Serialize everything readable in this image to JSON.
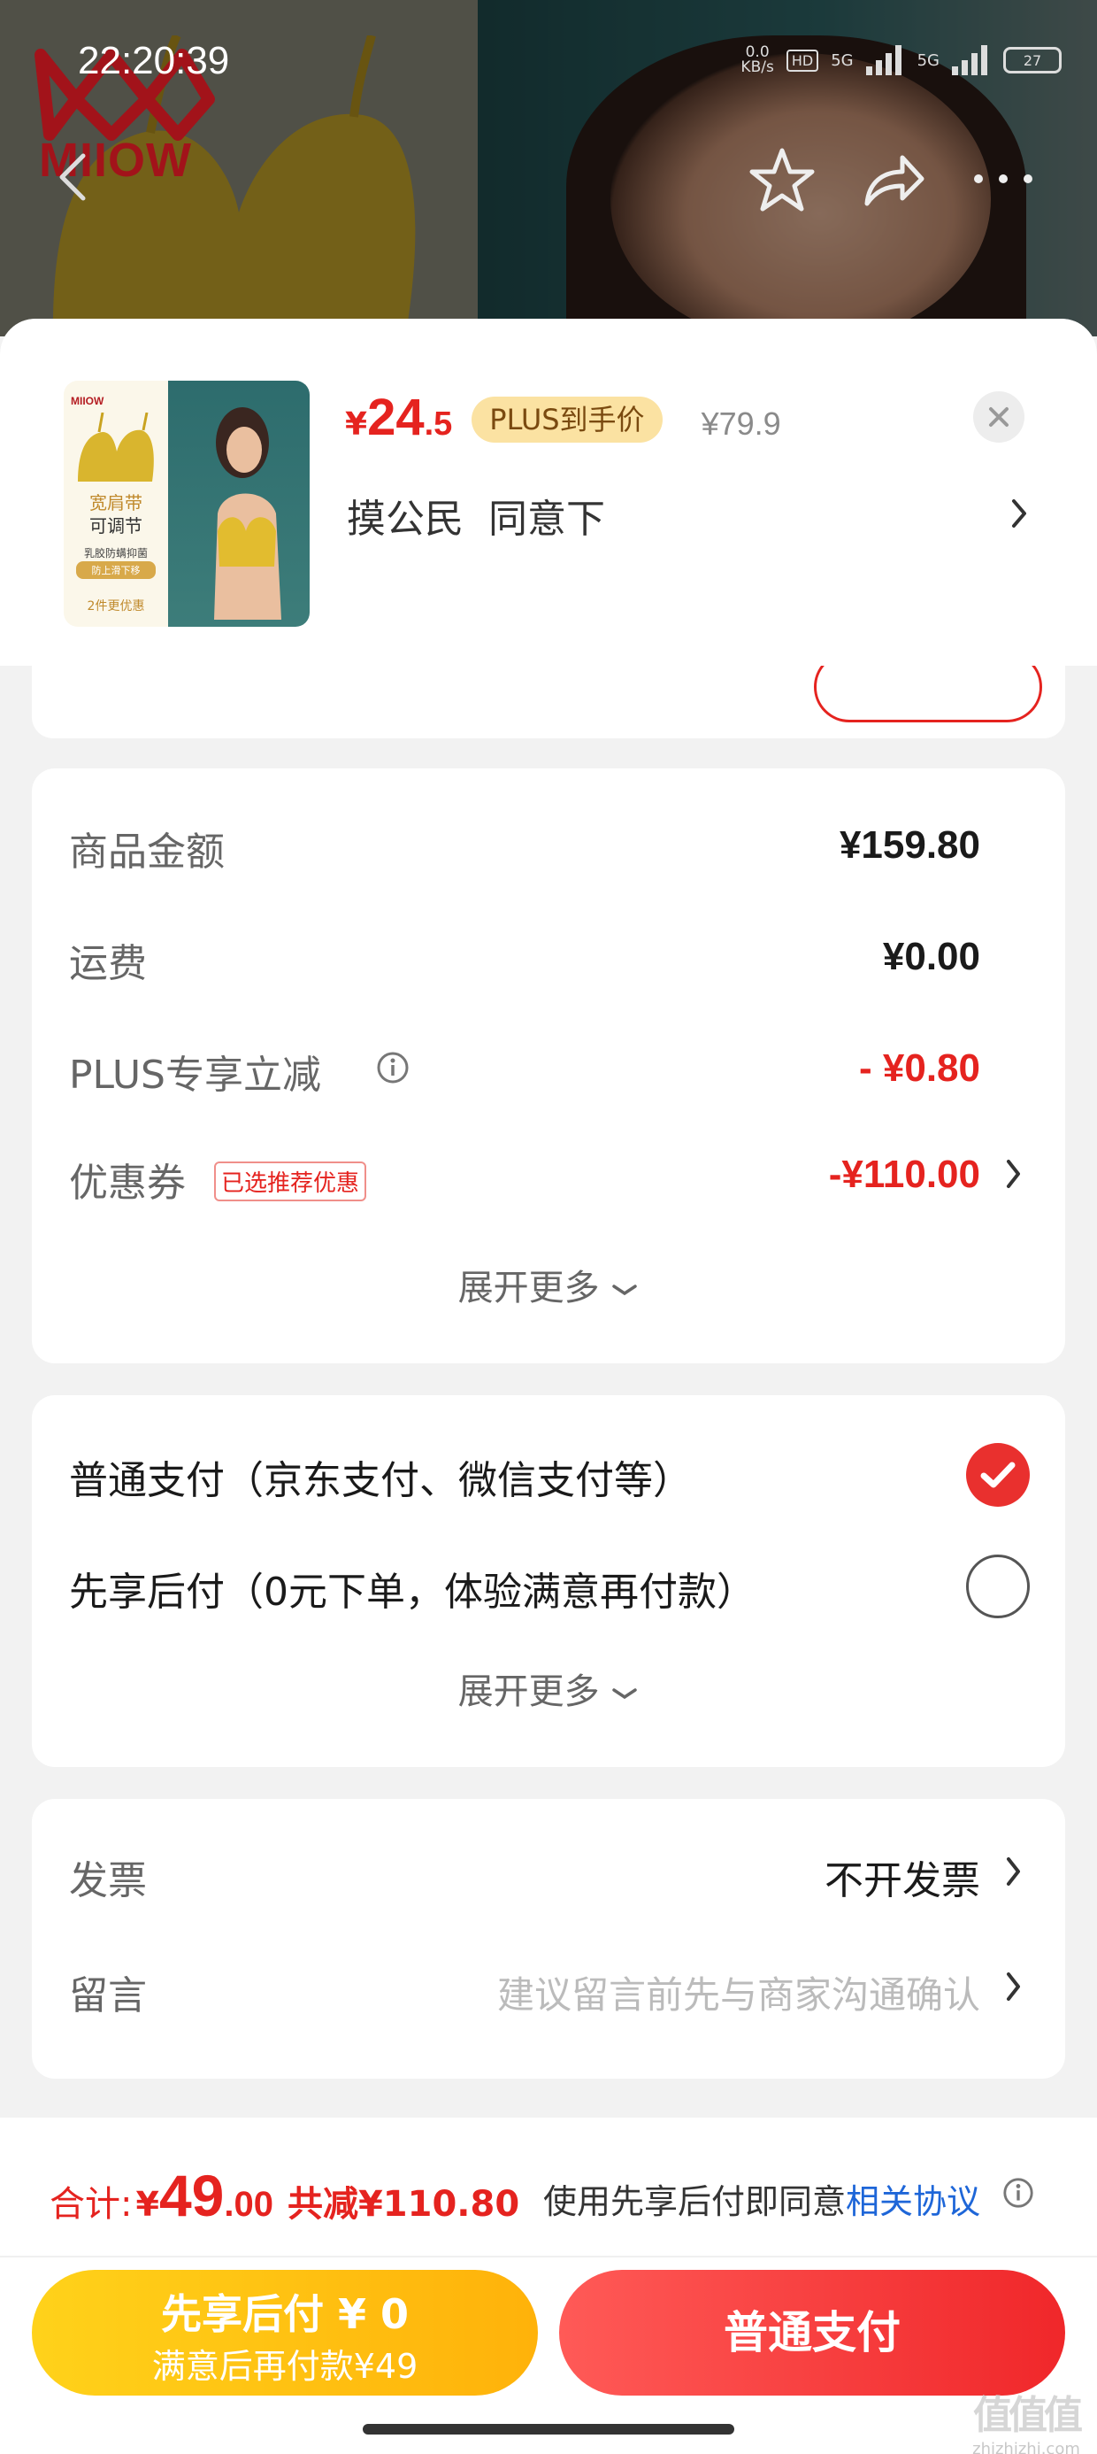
{
  "status_bar": {
    "time": "22:20:39",
    "net_speed_value": "0.0",
    "net_speed_unit": "KB/s",
    "hd_badge": "HD",
    "network_1": "5G",
    "network_2": "5G",
    "battery": "27"
  },
  "background": {
    "brand_logo_text": "MIIOW"
  },
  "product": {
    "image": {
      "logo_text": "MIIOW",
      "tag_line_1": "宽肩带",
      "tag_line_2": "可调节",
      "tag_line_3": "乳胶防螨抑菌",
      "tag_line_4": "防上滑下移",
      "tag_line_5": "2件更优惠"
    },
    "price_currency": "¥",
    "price_int": "24",
    "price_dec": ".5",
    "plus_badge": "PLUS到手价",
    "original_price": "¥79.9",
    "spec": "摸公民  同意下"
  },
  "summary": {
    "goods_label": "商品金额",
    "goods_value": "¥159.80",
    "shipping_label": "运费",
    "shipping_value": "¥0.00",
    "plus_label": "PLUS专享立减",
    "plus_value": "- ¥0.80",
    "coupon_label": "优惠券",
    "coupon_tag": "已选推荐优惠",
    "coupon_value": "-¥110.00",
    "expand_label": "展开更多"
  },
  "payment": {
    "option_1": "普通支付（京东支付、微信支付等）",
    "option_1_selected": true,
    "option_2": "先享后付（0元下单，体验满意再付款）",
    "option_2_selected": false,
    "expand_label": "展开更多"
  },
  "extras": {
    "invoice_label": "发票",
    "invoice_value": "不开发票",
    "message_label": "留言",
    "message_placeholder": "建议留言前先与商家沟通确认"
  },
  "footer": {
    "total_label": "合计:",
    "total_currency": "¥",
    "total_int": "49",
    "total_dec": ".00",
    "total_save": "共减¥110.80",
    "agree_text": "使用先享后付即同意",
    "agree_link": "相关协议",
    "btn_later_line1": "先享后付 ¥ 0",
    "btn_later_line2": "满意后再付款¥49",
    "btn_pay": "普通支付"
  },
  "watermark": {
    "mark": "值值值",
    "domain": "zhizhizhi.com"
  },
  "colors": {
    "accent_red": "#e5231f",
    "checkbox_red": "#e9302e",
    "link_blue": "#1e66d8",
    "later_button_yellow": "#ffc20f"
  }
}
